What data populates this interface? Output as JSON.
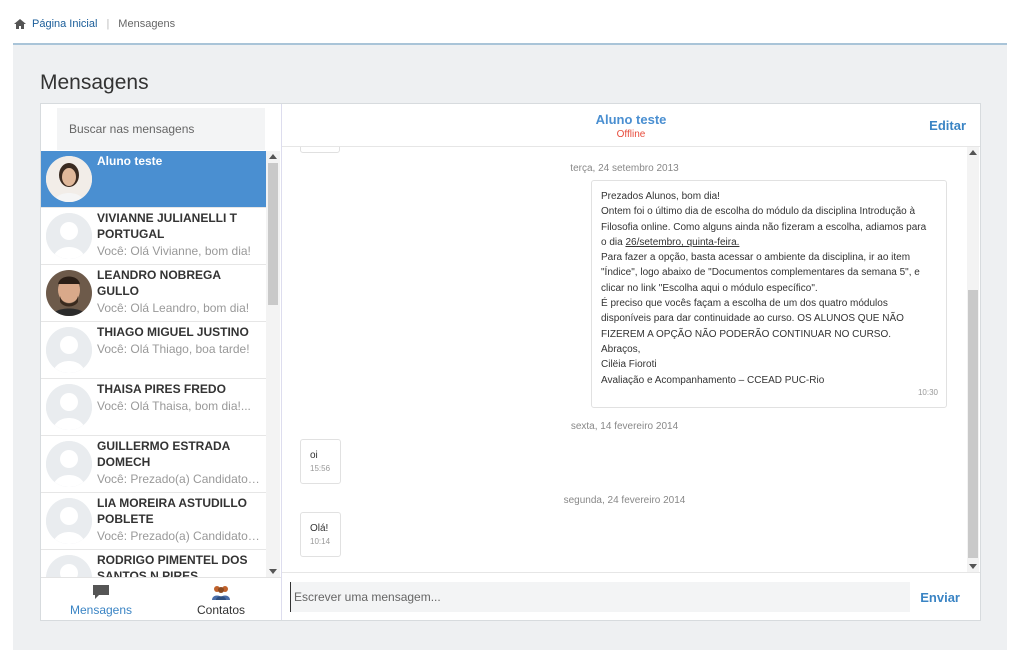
{
  "breadcrumb": {
    "home_label": "Página Inicial",
    "current": "Mensagens"
  },
  "page_title": "Mensagens",
  "search": {
    "placeholder": "Buscar nas mensagens"
  },
  "contacts": [
    {
      "name": "Aluno teste",
      "preview": "",
      "active": true,
      "avatar": "photo-woman"
    },
    {
      "name": "VIVIANNE JULIANELLI T PORTUGAL",
      "preview": "Você: Olá Vivianne, bom dia!",
      "avatar": "default"
    },
    {
      "name": "LEANDRO NOBREGA GULLO",
      "preview": "Você: Olá Leandro, bom dia!",
      "avatar": "photo-man"
    },
    {
      "name": "THIAGO MIGUEL JUSTINO",
      "preview": "Você: Olá Thiago, boa tarde!",
      "avatar": "default"
    },
    {
      "name": "THAISA PIRES FREDO",
      "preview": "Você: Olá Thaisa, bom dia!...",
      "avatar": "default"
    },
    {
      "name": "GUILLERMO ESTRADA DOMECH",
      "preview": "Você: Prezado(a) Candidato(a)",
      "avatar": "default"
    },
    {
      "name": "LIA MOREIRA ASTUDILLO POBLETE",
      "preview": "Você: Prezado(a) Candidato(a)",
      "avatar": "default"
    },
    {
      "name": "RODRIGO PIMENTEL DOS SANTOS N PIRES",
      "preview": "",
      "avatar": "default"
    }
  ],
  "tabs": {
    "messages": "Mensagens",
    "contacts": "Contatos"
  },
  "conversation": {
    "name": "Aluno teste",
    "status": "Offline",
    "edit_label": "Editar",
    "dates": [
      "terça, 24 setembro 2013",
      "sexta, 14 fevereiro 2014",
      "segunda, 24 fevereiro 2014"
    ],
    "long_message": {
      "lines": [
        "Prezados Alunos, bom dia!",
        "Ontem foi o último dia de escolha do módulo da disciplina Introdução à",
        "Filosofia online. Como alguns ainda não fizeram a escolha, adiamos para",
        "o dia ",
        "Para fazer a opção, basta acessar o ambiente da disciplina, ir ao item",
        "\"Índice\", logo abaixo de \"Documentos complementares da semana 5\", e",
        "clicar no link \"Escolha aqui o módulo específico\".",
        "É preciso que vocês façam a escolha de um dos quatro módulos",
        "disponíveis para dar continuidade ao curso. OS ALUNOS QUE NÃO",
        "FIZEREM A OPÇÃO NÃO PODERÃO CONTINUAR NO CURSO.",
        "Abraços,",
        "Cilëia Fioroti",
        "Avaliação e Acompanhamento – CCEAD PUC-Rio"
      ],
      "underlined_date": "26/setembro, quinta-feira.",
      "time": "10:30"
    },
    "msg2": {
      "text": "oi",
      "time": "15:56"
    },
    "msg3": {
      "text": "Olá!",
      "time": "10:14"
    }
  },
  "composer": {
    "placeholder": "Escrever uma mensagem...",
    "send_label": "Enviar"
  },
  "colors": {
    "accent": "#4a8fd1",
    "offline": "#e74c3c",
    "panel": "#eef0f2"
  }
}
